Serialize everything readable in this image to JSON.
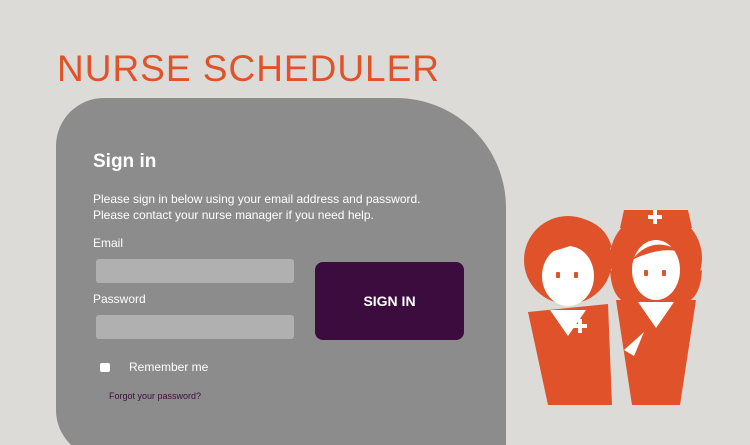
{
  "app": {
    "title": "NURSE SCHEDULER"
  },
  "signin": {
    "heading": "Sign in",
    "description_line1": "Please sign in below using your email address and password.",
    "description_line2": "Please contact your nurse manager if you need help.",
    "email_label": "Email",
    "email_value": "",
    "password_label": "Password",
    "password_value": "",
    "button_label": "SIGN IN",
    "remember_label": "Remember me",
    "remember_checked": false,
    "forgot_link": "Forgot your password?"
  },
  "illustration": {
    "icon": "nurses-icon"
  },
  "colors": {
    "background": "#dddbd8",
    "accent": "#e0532a",
    "card": "#8c8c8c",
    "button": "#3c0c3e",
    "input": "#b0b0b0"
  }
}
